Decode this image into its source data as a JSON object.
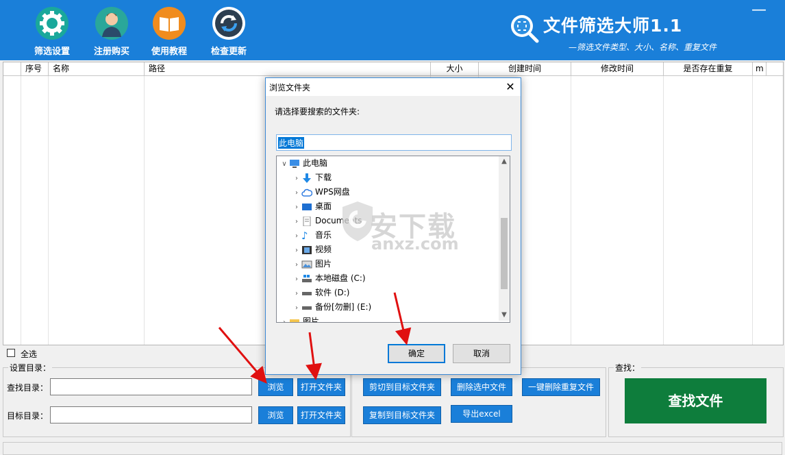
{
  "toolbar": {
    "items": [
      {
        "label": "筛选设置",
        "icon": "gear-icon",
        "color": "#1aa89b"
      },
      {
        "label": "注册购买",
        "icon": "user-icon",
        "color": "#2aa79a"
      },
      {
        "label": "使用教程",
        "icon": "book-icon",
        "color": "#f08c1e"
      },
      {
        "label": "检查更新",
        "icon": "refresh-icon",
        "color": "#ffffff"
      }
    ]
  },
  "app": {
    "title": "文件筛选大师1.1",
    "subtitle": "—筛选文件类型、大小、名称、重复文件",
    "minimize": "—"
  },
  "table": {
    "columns": [
      "序号",
      "名称",
      "路径",
      "大小",
      "创建时间",
      "修改时间",
      "是否存在重复",
      "m"
    ]
  },
  "select_all": "全选",
  "dir_panel": {
    "title": "设置目录：",
    "search_dir_label": "查找目录：",
    "target_dir_label": "目标目录：",
    "search_dir_value": "",
    "target_dir_value": "",
    "browse": "浏览",
    "open_folder": "打开文件夹"
  },
  "actions": {
    "cut_to_target": "剪切到目标文件夹",
    "delete_selected": "删除选中文件",
    "delete_duplicates": "一键删除重复文件",
    "copy_to_target": "复制到目标文件夹",
    "export_excel": "导出excel"
  },
  "find_panel": {
    "title": "查找：",
    "button": "查找文件",
    "button_color": "#0e7d3c"
  },
  "dialog": {
    "title": "浏览文件夹",
    "prompt": "请选择要搜索的文件夹:",
    "selected": "此电脑",
    "tree": [
      {
        "label": "此电脑",
        "icon": "computer-icon",
        "expanded": true
      },
      {
        "label": "下载",
        "icon": "download-icon"
      },
      {
        "label": "WPS网盘",
        "icon": "cloud-icon"
      },
      {
        "label": "桌面",
        "icon": "desktop-icon"
      },
      {
        "label": "Documents",
        "icon": "document-icon"
      },
      {
        "label": "音乐",
        "icon": "music-icon"
      },
      {
        "label": "视频",
        "icon": "video-icon"
      },
      {
        "label": "图片",
        "icon": "picture-icon"
      },
      {
        "label": "本地磁盘 (C:)",
        "icon": "drive-icon"
      },
      {
        "label": "软件 (D:)",
        "icon": "drive-icon"
      },
      {
        "label": "备份[勿删] (E:)",
        "icon": "drive-icon"
      },
      {
        "label": "图片",
        "icon": "folder-icon"
      }
    ],
    "ok": "确定",
    "cancel": "取消"
  },
  "watermark": {
    "text": "安下载",
    "domain": "anxz.com"
  }
}
